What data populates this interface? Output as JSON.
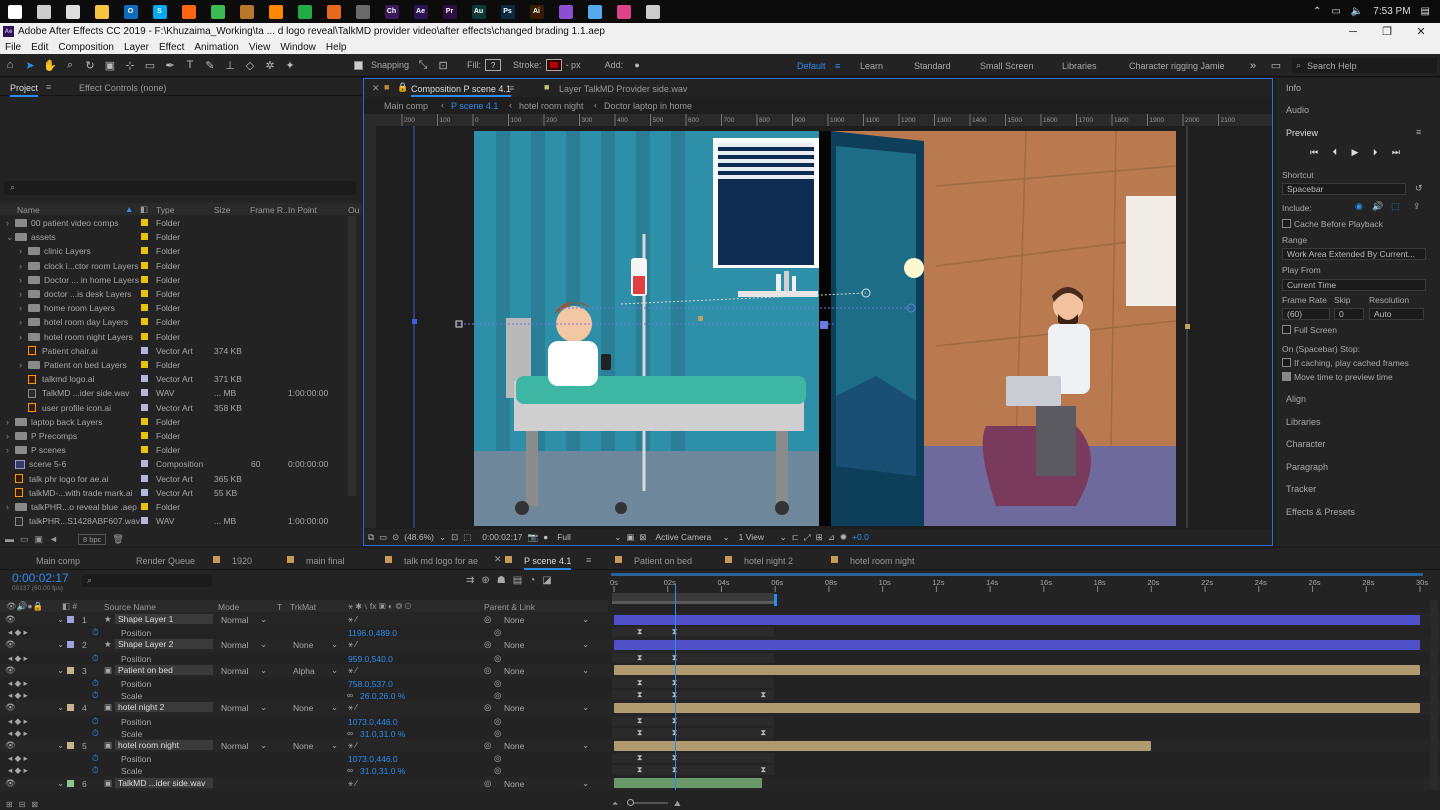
{
  "taskbar": {
    "time": "7:53 PM",
    "apps": [
      {
        "name": "start-icon",
        "color": "#ffffff",
        "glyph": ""
      },
      {
        "name": "task-view-icon",
        "color": "#cccccc",
        "glyph": ""
      },
      {
        "name": "new-window-icon",
        "color": "#dddddd",
        "glyph": ""
      },
      {
        "name": "file-explorer-icon",
        "color": "#f5c542",
        "glyph": ""
      },
      {
        "name": "outlook-icon",
        "color": "#0f6cbd",
        "glyph": "O"
      },
      {
        "name": "skype-icon",
        "color": "#00a9f0",
        "glyph": "S"
      },
      {
        "name": "firefox-icon",
        "color": "#ff6611",
        "glyph": ""
      },
      {
        "name": "chrome-icon",
        "color": "#3cba54",
        "glyph": ""
      },
      {
        "name": "app-icon-1",
        "color": "#b9772b",
        "glyph": ""
      },
      {
        "name": "vlc-icon",
        "color": "#ff8800",
        "glyph": ""
      },
      {
        "name": "app-icon-2",
        "color": "#22aa44",
        "glyph": ""
      },
      {
        "name": "app-icon-3",
        "color": "#e8681c",
        "glyph": ""
      },
      {
        "name": "obs-icon",
        "color": "#6a6a6a",
        "glyph": ""
      },
      {
        "name": "character-animator-icon",
        "color": "#3a1a5a",
        "glyph": "Ch"
      },
      {
        "name": "after-effects-icon",
        "color": "#2a1550",
        "glyph": "Ae"
      },
      {
        "name": "premiere-icon",
        "color": "#2a0f40",
        "glyph": "Pr"
      },
      {
        "name": "audition-icon",
        "color": "#0f3a34",
        "glyph": "Au"
      },
      {
        "name": "photoshop-icon",
        "color": "#0a2a40",
        "glyph": "Ps"
      },
      {
        "name": "illustrator-icon",
        "color": "#3a1c00",
        "glyph": "Ai"
      },
      {
        "name": "pen-app-icon",
        "color": "#8a50d0",
        "glyph": ""
      },
      {
        "name": "ink-icon",
        "color": "#55aaee",
        "glyph": ""
      },
      {
        "name": "color-app-icon",
        "color": "#dd4488",
        "glyph": ""
      },
      {
        "name": "photos-icon",
        "color": "#cccccc",
        "glyph": ""
      }
    ]
  },
  "window": {
    "title": "Adobe After Effects CC 2019 - F:\\Khuzaima_Working\\ta ... d logo reveal\\TalkMD provider video\\after effects\\changed brading 1.1.aep"
  },
  "menu": [
    "File",
    "Edit",
    "Composition",
    "Layer",
    "Effect",
    "Animation",
    "View",
    "Window",
    "Help"
  ],
  "toolbar": {
    "snapping": "Snapping",
    "fill": "Fill:",
    "fill_value": "?",
    "stroke": "Stroke:",
    "px": "- px",
    "add": "Add:",
    "workspaces": [
      "Default",
      "Learn",
      "Standard",
      "Small Screen",
      "Libraries",
      "Character rigging Jamie"
    ],
    "search": "Search Help"
  },
  "project": {
    "tab": "Project",
    "effect_controls": "Effect Controls (none)",
    "columns": {
      "name": "Name",
      "type": "Type",
      "size": "Size",
      "frame_rate": "Frame R...",
      "in_point": "In Point",
      "out": "Ou"
    },
    "items": [
      {
        "indent": 0,
        "icon": "folder",
        "name": "00 patient video comps",
        "label": "#e8c400",
        "type": "Folder",
        "size": "",
        "fr": "",
        "in": "",
        "expanded": false
      },
      {
        "indent": 0,
        "icon": "folder",
        "name": "assets",
        "label": "#e8c400",
        "type": "Folder",
        "size": "",
        "fr": "",
        "in": "",
        "expanded": true
      },
      {
        "indent": 1,
        "icon": "folder",
        "name": "clinic Layers",
        "label": "#e8c400",
        "type": "Folder",
        "size": "",
        "fr": "",
        "in": "",
        "expanded": false
      },
      {
        "indent": 1,
        "icon": "folder",
        "name": "clock i...ctor room Layers",
        "label": "#e8c400",
        "type": "Folder",
        "size": "",
        "fr": "",
        "in": "",
        "expanded": false
      },
      {
        "indent": 1,
        "icon": "folder",
        "name": "Doctor ... in home Layers",
        "label": "#e8c400",
        "type": "Folder",
        "size": "",
        "fr": "",
        "in": "",
        "expanded": false
      },
      {
        "indent": 1,
        "icon": "folder",
        "name": "doctor ...is desk Layers",
        "label": "#e8c400",
        "type": "Folder",
        "size": "",
        "fr": "",
        "in": "",
        "expanded": false
      },
      {
        "indent": 1,
        "icon": "folder",
        "name": "home room Layers",
        "label": "#e8c400",
        "type": "Folder",
        "size": "",
        "fr": "",
        "in": "",
        "expanded": false
      },
      {
        "indent": 1,
        "icon": "folder",
        "name": "hotel room day Layers",
        "label": "#e8c400",
        "type": "Folder",
        "size": "",
        "fr": "",
        "in": "",
        "expanded": false
      },
      {
        "indent": 1,
        "icon": "folder",
        "name": "hotel room night Layers",
        "label": "#e8c400",
        "type": "Folder",
        "size": "",
        "fr": "",
        "in": "",
        "expanded": false
      },
      {
        "indent": 1,
        "icon": "ai",
        "name": "Patient chair.ai",
        "label": "#b4b4dc",
        "type": "Vector Art",
        "size": "374 KB",
        "fr": "",
        "in": "",
        "expanded": null
      },
      {
        "indent": 1,
        "icon": "folder",
        "name": "Patient on bed Layers",
        "label": "#e8c400",
        "type": "Folder",
        "size": "",
        "fr": "",
        "in": "",
        "expanded": false
      },
      {
        "indent": 1,
        "icon": "ai",
        "name": "talkmd logo.ai",
        "label": "#b4b4dc",
        "type": "Vector Art",
        "size": "371 KB",
        "fr": "",
        "in": "",
        "expanded": null
      },
      {
        "indent": 1,
        "icon": "wav",
        "name": "TalkMD ...ider side.wav",
        "label": "#b4b4dc",
        "type": "WAV",
        "size": "... MB",
        "fr": "",
        "in": "1:00:00:00",
        "expanded": null
      },
      {
        "indent": 1,
        "icon": "ai",
        "name": "user profile icon.ai",
        "label": "#b4b4dc",
        "type": "Vector Art",
        "size": "358 KB",
        "fr": "",
        "in": "",
        "expanded": null
      },
      {
        "indent": 0,
        "icon": "folder",
        "name": "laptop back Layers",
        "label": "#e8c400",
        "type": "Folder",
        "size": "",
        "fr": "",
        "in": "",
        "expanded": false
      },
      {
        "indent": 0,
        "icon": "folder",
        "name": "P Precomps",
        "label": "#e8c400",
        "type": "Folder",
        "size": "",
        "fr": "",
        "in": "",
        "expanded": false
      },
      {
        "indent": 0,
        "icon": "folder",
        "name": "P scenes",
        "label": "#e8c400",
        "type": "Folder",
        "size": "",
        "fr": "",
        "in": "",
        "expanded": false
      },
      {
        "indent": 0,
        "icon": "comp",
        "name": "scene 5-6",
        "label": "#b4b4dc",
        "type": "Composition",
        "size": "",
        "fr": "60",
        "in": "0:00:00:00",
        "expanded": null
      },
      {
        "indent": 0,
        "icon": "ai",
        "name": "talk phr logo for ae.ai",
        "label": "#b4b4dc",
        "type": "Vector Art",
        "size": "365 KB",
        "fr": "",
        "in": "",
        "expanded": null
      },
      {
        "indent": 0,
        "icon": "ai",
        "name": "talkMD-...with trade mark.ai",
        "label": "#b4b4dc",
        "type": "Vector Art",
        "size": "55 KB",
        "fr": "",
        "in": "",
        "expanded": null
      },
      {
        "indent": 0,
        "icon": "folder",
        "name": "talkPHR...o reveal blue .aep",
        "label": "#e8c400",
        "type": "Folder",
        "size": "",
        "fr": "",
        "in": "",
        "expanded": false
      },
      {
        "indent": 0,
        "icon": "wav",
        "name": "talkPHR...S1428ABF607.wav",
        "label": "#b4b4dc",
        "type": "WAV",
        "size": "... MB",
        "fr": "",
        "in": "1:00:00:00",
        "expanded": null
      }
    ],
    "bpc": "8 bpc"
  },
  "viewer": {
    "comp_tab": "Composition P scene 4.1",
    "layer_tab": "Layer TalkMD Provider side.wav",
    "breadcrumbs": [
      "Main comp",
      "P scene 4.1",
      "hotel room night",
      "Doctor laptop in home"
    ],
    "ruler": [
      "200",
      "100",
      "0",
      "100",
      "200",
      "300",
      "400",
      "500",
      "600",
      "700",
      "800",
      "900",
      "1000",
      "1100",
      "1200",
      "1300",
      "1400",
      "1500",
      "1600",
      "1700",
      "1800",
      "1900",
      "2000",
      "2100"
    ],
    "zoom": "(48.6%)",
    "time": "0:00:02:17",
    "resolution": "Full",
    "camera": "Active Camera",
    "views": "1 View",
    "exposure": "+0.0"
  },
  "right_panel": {
    "info": "Info",
    "audio": "Audio",
    "preview": "Preview",
    "shortcut": "Shortcut",
    "shortcut_value": "Spacebar",
    "include": "Include:",
    "cache": "Cache Before Playback",
    "range": "Range",
    "range_value": "Work Area Extended By Current...",
    "play_from": "Play From",
    "play_from_value": "Current Time",
    "frame_rate": "Frame Rate",
    "skip": "Skip",
    "resolution": "Resolution",
    "fr_value": "(60)",
    "skip_value": "0",
    "res_value": "Auto",
    "full_screen": "Full Screen",
    "on_stop": "On (Spacebar) Stop:",
    "if_caching": "If caching, play cached frames",
    "move_time": "Move time to preview time",
    "sections": [
      "Align",
      "Libraries",
      "Character",
      "Paragraph",
      "Tracker",
      "Effects & Presets"
    ]
  },
  "timeline": {
    "tabs": [
      {
        "label": "Main comp",
        "active": false
      },
      {
        "label": "Render Queue",
        "active": false
      },
      {
        "label": "1920",
        "active": false
      },
      {
        "label": "main final",
        "active": false
      },
      {
        "label": "talk md logo for ae",
        "active": false
      },
      {
        "label": "P scene 4.1",
        "active": true
      },
      {
        "label": "Patient on bed",
        "active": false
      },
      {
        "label": "hotel night 2",
        "active": false
      },
      {
        "label": "hotel room night",
        "active": false
      }
    ],
    "current_time": "0:00:02:17",
    "frames": "00137 (60.00 fps)",
    "cols": {
      "source": "Source Name",
      "mode": "Mode",
      "t": "T",
      "trkmat": "TrkMat",
      "parent": "Parent & Link"
    },
    "ruler": [
      "0s",
      "02s",
      "04s",
      "06s",
      "08s",
      "10s",
      "12s",
      "14s",
      "16s",
      "18s",
      "20s",
      "22s",
      "24s",
      "26s",
      "28s",
      "30s"
    ],
    "rows": [
      {
        "kind": "layer",
        "num": "1",
        "name": "Shape Layer 1",
        "label": "#a0a0e0",
        "mode": "Normal",
        "trk": "",
        "parent": "None",
        "bar": "#5050c8",
        "start": 0,
        "end": 30,
        "star": true
      },
      {
        "kind": "prop",
        "name": "Position",
        "value": "1196.0,489.0",
        "kfs": [
          1.0,
          2.3
        ]
      },
      {
        "kind": "layer",
        "num": "2",
        "name": "Shape Layer 2",
        "label": "#a0a0e0",
        "mode": "Normal",
        "trk": "None",
        "parent": "None",
        "bar": "#5050c8",
        "start": 0,
        "end": 30,
        "star": true
      },
      {
        "kind": "prop",
        "name": "Position",
        "value": "959.0,540.0",
        "kfs": [
          1.0,
          2.3
        ]
      },
      {
        "kind": "layer",
        "num": "3",
        "name": "Patient on bed",
        "label": "#c8b48c",
        "mode": "Normal",
        "trk": "Alpha",
        "parent": "None",
        "bar": "#b09a70",
        "start": 0,
        "end": 30,
        "star": false
      },
      {
        "kind": "prop",
        "name": "Position",
        "value": "758.0,537.0",
        "kfs": [
          1.0,
          2.3
        ]
      },
      {
        "kind": "prop",
        "name": "Scale",
        "value": "26.0,26.0 %",
        "kfs": [
          1.0,
          2.3,
          5.6
        ]
      },
      {
        "kind": "layer",
        "num": "4",
        "name": "hotel night 2",
        "label": "#c8b48c",
        "mode": "Normal",
        "trk": "None",
        "parent": "None",
        "bar": "#b09a70",
        "start": 0,
        "end": 30,
        "star": false
      },
      {
        "kind": "prop",
        "name": "Position",
        "value": "1073.0,446.0",
        "kfs": [
          1.0,
          2.3
        ]
      },
      {
        "kind": "prop",
        "name": "Scale",
        "value": "31.0,31.0 %",
        "kfs": [
          1.0,
          2.3,
          5.6
        ]
      },
      {
        "kind": "layer",
        "num": "5",
        "name": "hotel room night",
        "label": "#c8b48c",
        "mode": "Normal",
        "trk": "None",
        "parent": "None",
        "bar": "#b09a70",
        "start": 0,
        "end": 20,
        "star": false
      },
      {
        "kind": "prop",
        "name": "Position",
        "value": "1073.0,446.0",
        "kfs": [
          1.0,
          2.3
        ]
      },
      {
        "kind": "prop",
        "name": "Scale",
        "value": "31.0,31.0 %",
        "kfs": [
          1.0,
          2.3,
          5.6
        ]
      },
      {
        "kind": "layer",
        "num": "6",
        "name": "TalkMD ...ider side.wav",
        "label": "#8cc88c",
        "mode": "",
        "trk": "",
        "parent": "None",
        "bar": "#6a9a6a",
        "start": 0,
        "end": 5.5,
        "star": false
      }
    ]
  }
}
